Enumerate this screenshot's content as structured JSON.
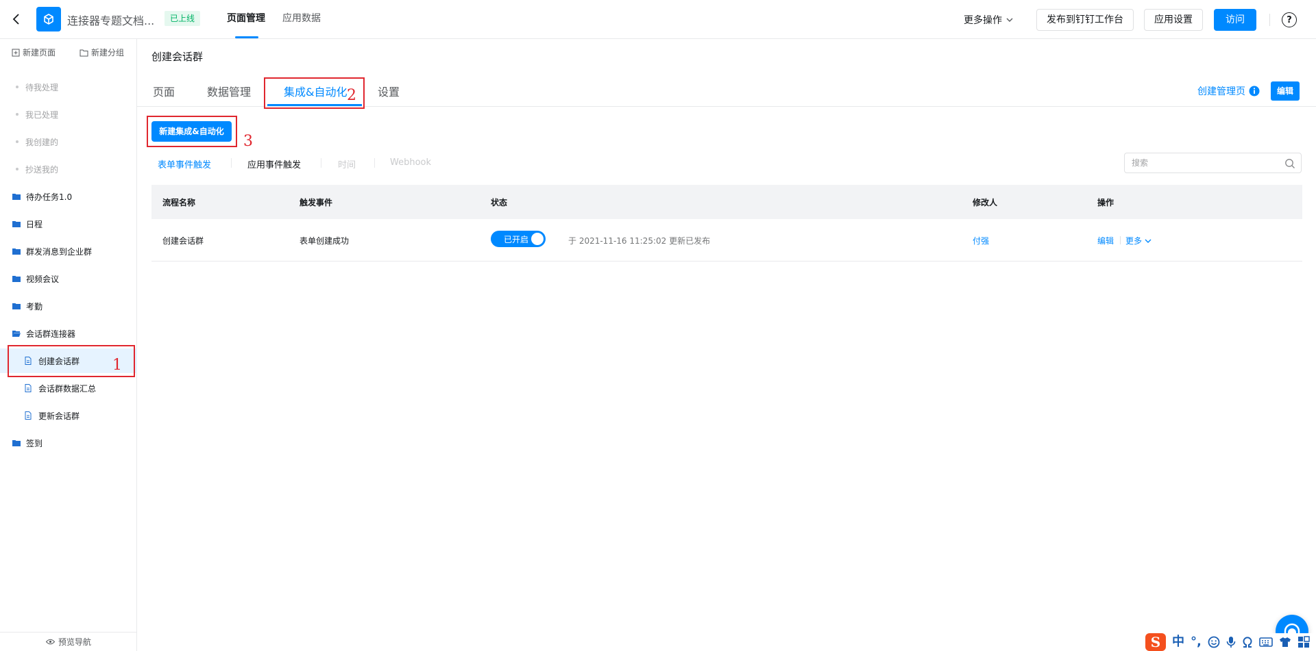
{
  "topbar": {
    "app_name": "连接器专题文档...",
    "status_badge": "已上线",
    "tabs": [
      "页面管理",
      "应用数据"
    ],
    "more_actions": "更多操作",
    "publish_btn": "发布到钉钉工作台",
    "settings_btn": "应用设置",
    "visit_btn": "访问",
    "help_glyph": "?"
  },
  "sidebar": {
    "new_page": "新建页面",
    "new_group": "新建分组",
    "items": [
      {
        "label": "待我处理"
      },
      {
        "label": "我已处理"
      },
      {
        "label": "我创建的"
      },
      {
        "label": "抄送我的"
      },
      {
        "label": "待办任务1.0"
      },
      {
        "label": "日程"
      },
      {
        "label": "群发消息到企业群"
      },
      {
        "label": "视频会议"
      },
      {
        "label": "考勤"
      },
      {
        "label": "会话群连接器"
      },
      {
        "label": "创建会话群"
      },
      {
        "label": "会话群数据汇总"
      },
      {
        "label": "更新会话群"
      },
      {
        "label": "签到"
      }
    ],
    "footer": "预览导航"
  },
  "main": {
    "title": "创建会话群",
    "tabs": [
      "页面",
      "数据管理",
      "集成&自动化",
      "设置"
    ],
    "create_admin": "创建管理页",
    "edit_btn": "编辑",
    "new_btn": "新建集成&自动化",
    "filters": [
      "表单事件触发",
      "应用事件触发",
      "时间",
      "Webhook"
    ],
    "search_placeholder": "搜索",
    "table": {
      "headers": [
        "流程名称",
        "触发事件",
        "状态",
        "修改人",
        "操作"
      ],
      "rows": [
        {
          "name": "创建会话群",
          "event": "表单创建成功",
          "status": "已开启",
          "updated": "于 2021-11-16 11:25:02 更新已发布",
          "modifier": "付强",
          "edit": "编辑",
          "more": "更多"
        }
      ]
    }
  },
  "annotations": [
    "1",
    "2",
    "3"
  ],
  "ime": {
    "mode": "中",
    "punct": "°,"
  },
  "colors": {
    "accent": "#0089ff",
    "annotation": "#e0262e",
    "online": "#00b365"
  }
}
